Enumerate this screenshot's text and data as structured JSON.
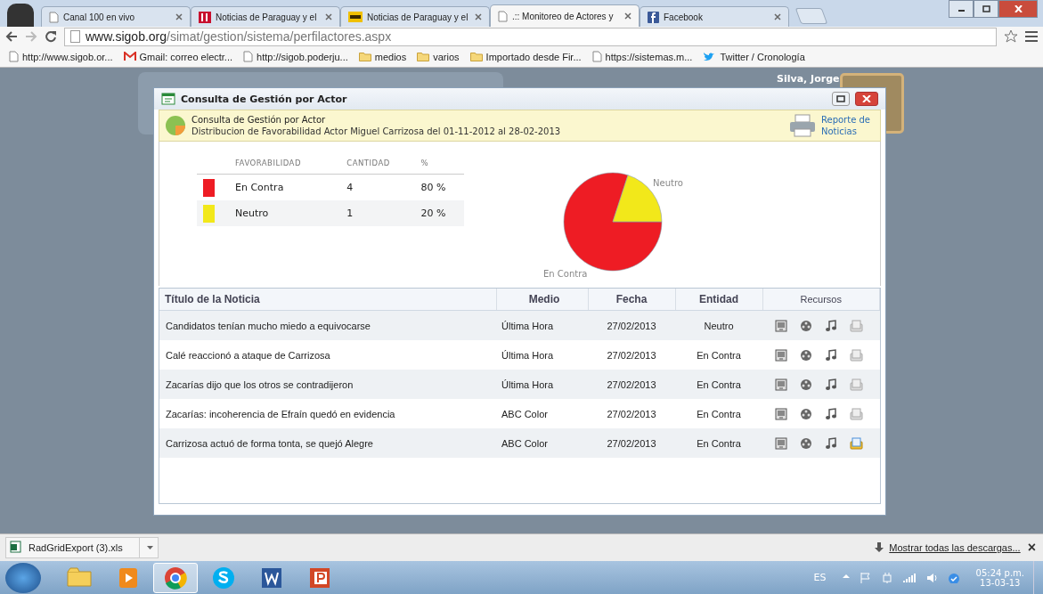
{
  "browser": {
    "tabs": [
      {
        "title": "Canal 100 en vivo",
        "kind": "page",
        "selected": false
      },
      {
        "title": "Noticias de Paraguay y el",
        "kind": "uh",
        "selected": false
      },
      {
        "title": "Noticias de Paraguay y el",
        "kind": "abc",
        "selected": false
      },
      {
        "title": ".:: Monitoreo de Actores y",
        "kind": "page",
        "selected": true
      },
      {
        "title": "Facebook",
        "kind": "facebook",
        "selected": false
      }
    ],
    "url_host": "www.sigob.org",
    "url_path": "/simat/gestion/sistema/perfilactores.aspx",
    "bookmarks": [
      {
        "label": "http://www.sigob.or...",
        "kind": "page"
      },
      {
        "label": "Gmail: correo electr...",
        "kind": "gmail"
      },
      {
        "label": "http://sigob.poderju...",
        "kind": "page"
      },
      {
        "label": "medios",
        "kind": "folder"
      },
      {
        "label": "varios",
        "kind": "folder"
      },
      {
        "label": "Importado desde Fir...",
        "kind": "folder"
      },
      {
        "label": "https://sistemas.m...",
        "kind": "page"
      },
      {
        "label": "Twitter / Cronología",
        "kind": "twitter"
      }
    ]
  },
  "page": {
    "user_name": "Silva, Jorge"
  },
  "dialog": {
    "title": "Consulta de Gestión por Actor",
    "header_title": "Consulta de Gestión por Actor",
    "header_subtitle": "Distribucion de Favorabilidad Actor Miguel Carrizosa del 01-11-2012 al 28-02-2013",
    "report_link": "Reporte de Noticias",
    "legend": {
      "columns": [
        "FAVORABILIDAD",
        "CANTIDAD",
        "%"
      ],
      "rows": [
        {
          "label": "En Contra",
          "count": "4",
          "percent": "80 %",
          "color": "#ee1c24"
        },
        {
          "label": "Neutro",
          "count": "1",
          "percent": "20 %",
          "color": "#f2e81a"
        }
      ]
    },
    "chart_data": {
      "type": "pie",
      "categories": [
        "En Contra",
        "Neutro"
      ],
      "values": [
        80,
        20
      ]
    },
    "grid": {
      "columns": [
        "Título de la Noticia",
        "Medio",
        "Fecha",
        "Entidad",
        "Recursos"
      ],
      "rows": [
        {
          "title": "Candidatos tenían mucho miedo a equivocarse",
          "medio": "Última Hora",
          "fecha": "27/02/2013",
          "entidad": "Neutro",
          "document_available": false
        },
        {
          "title": "Calé reaccionó a ataque de Carrizosa",
          "medio": "Última Hora",
          "fecha": "27/02/2013",
          "entidad": "En Contra",
          "document_available": false
        },
        {
          "title": "Zacarías dijo que los otros se contradijeron",
          "medio": "Última Hora",
          "fecha": "27/02/2013",
          "entidad": "En Contra",
          "document_available": false
        },
        {
          "title": "Zacarías: incoherencia de Efraín quedó en evidencia",
          "medio": "ABC Color",
          "fecha": "27/02/2013",
          "entidad": "En Contra",
          "document_available": false
        },
        {
          "title": "Carrizosa actuó de forma tonta, se quejó Alegre",
          "medio": "ABC Color",
          "fecha": "27/02/2013",
          "entidad": "En Contra",
          "document_available": true
        }
      ]
    }
  },
  "downloads": {
    "file": "RadGridExport (3).xls",
    "show_all": "Mostrar todas las descargas...",
    "close": "×"
  },
  "taskbar": {
    "apps": [
      {
        "kind": "explorer",
        "selected": false
      },
      {
        "kind": "media",
        "selected": false
      },
      {
        "kind": "chrome",
        "selected": true
      },
      {
        "kind": "skype",
        "selected": false
      },
      {
        "kind": "word",
        "selected": false
      },
      {
        "kind": "powerpoint",
        "selected": false
      }
    ],
    "language": "ES",
    "time": "05:24 p.m.",
    "date": "13-03-13"
  }
}
